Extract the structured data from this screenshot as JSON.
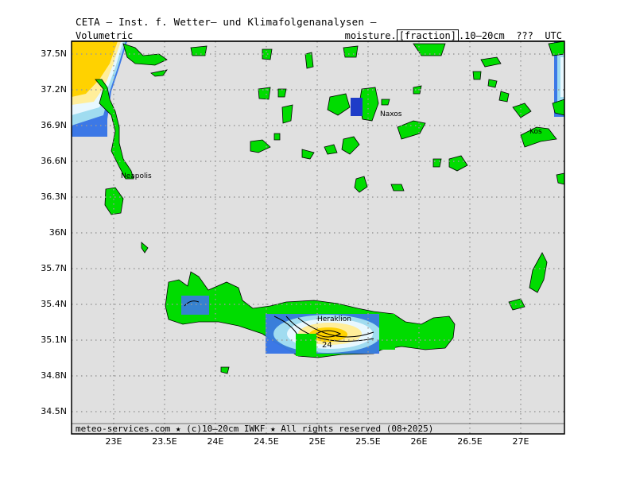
{
  "header": {
    "title": "CETA — Inst. f. Wetter— und Klimafolgenanalysen —",
    "left_label": "Volumetric",
    "variable_prefix": "moisture.",
    "variable_unit": "[fraction]",
    "variable_suffix": ".10—20cm  ???  UTC"
  },
  "footer": {
    "text": "meteo-services.com ★ (c)10—20cm IWKF ★ All rights reserved (08+2025)"
  },
  "axes": {
    "lat_labels": [
      "37.5N",
      "37.2N",
      "36.9N",
      "36.6N",
      "36.3N",
      "36N",
      "35.7N",
      "35.4N",
      "35.1N",
      "34.8N",
      "34.5N"
    ],
    "lon_labels": [
      "23E",
      "23.5E",
      "24E",
      "24.5E",
      "25E",
      "25.5E",
      "26E",
      "26.5E",
      "27E"
    ]
  },
  "places": {
    "naxos": "Naxos",
    "kos": "Kos",
    "neapolis": "Neapolis",
    "heraklion": "Heraklion",
    "contour_value": "24"
  },
  "colors": {
    "background": "#e0e0e0",
    "land": "#00dc00",
    "grid": "#999999",
    "moisture_high": "#ffd200",
    "moisture_mid_high": "#ffee9a",
    "moisture_mid": "#e8f8ff",
    "moisture_mid_low": "#a0dcf0",
    "moisture_low": "#3c78e6",
    "moisture_lowest": "#1e3cc8"
  }
}
